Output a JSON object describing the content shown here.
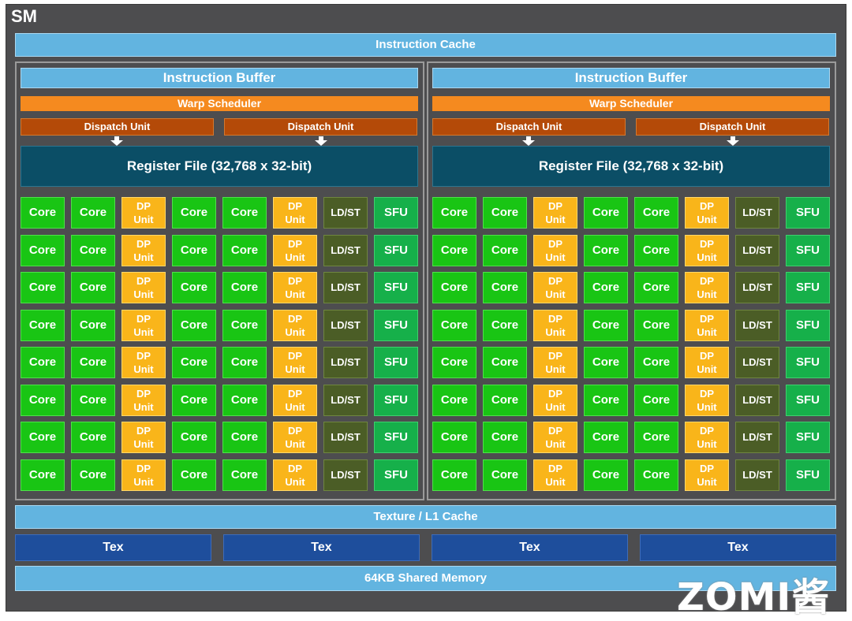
{
  "sm_title": "SM",
  "instruction_cache": "Instruction Cache",
  "blocks": [
    {
      "instruction_buffer": "Instruction Buffer",
      "warp_scheduler": "Warp Scheduler",
      "dispatch_units": [
        "Dispatch Unit",
        "Dispatch Unit"
      ],
      "register_file": "Register File (32,768 x 32-bit)"
    },
    {
      "instruction_buffer": "Instruction Buffer",
      "warp_scheduler": "Warp Scheduler",
      "dispatch_units": [
        "Dispatch Unit",
        "Dispatch Unit"
      ],
      "register_file": "Register File (32,768 x 32-bit)"
    }
  ],
  "unit_row": [
    "Core",
    "Core",
    "DP Unit",
    "Core",
    "Core",
    "DP Unit",
    "LD/ST",
    "SFU"
  ],
  "rows_per_block": 8,
  "texture_l1_cache": "Texture / L1 Cache",
  "tex_units": [
    "Tex",
    "Tex",
    "Tex",
    "Tex"
  ],
  "shared_memory": "64KB Shared Memory",
  "watermark": "ZOMI酱",
  "colors": {
    "core": "#19c514",
    "dp_unit": "#f9b51a",
    "ld_st": "#4b5d26",
    "sfu": "#16b04a",
    "warp_scheduler": "#f58a1f",
    "dispatch_unit": "#b44a08",
    "register_file": "#0b4e66",
    "cache": "#62b4e0",
    "tex": "#1e4e9c"
  }
}
